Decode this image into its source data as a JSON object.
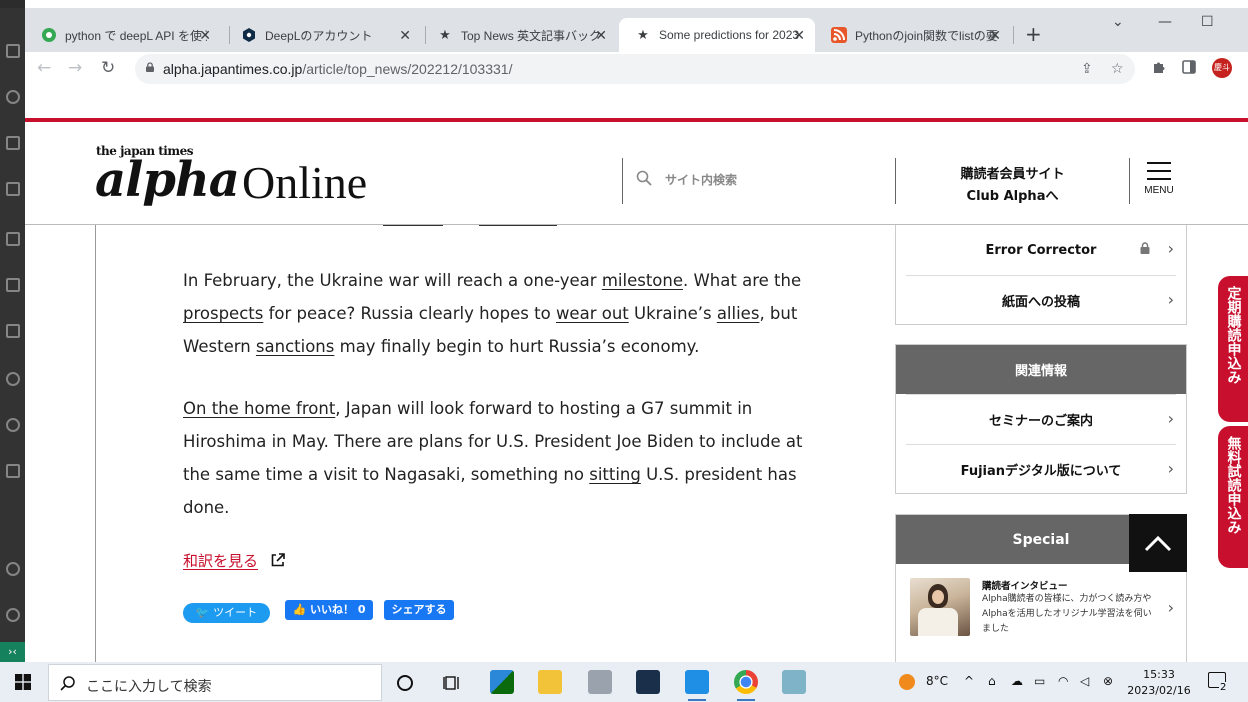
{
  "browser": {
    "tabs": [
      {
        "title": "python で deepL API を使う",
        "favicon": "circle-green-icon",
        "color": "#34a853"
      },
      {
        "title": "DeepLのアカウント",
        "favicon": "deepl-icon",
        "color": "#0f2b46"
      },
      {
        "title": "Top News 英文記事バックナ",
        "favicon": "star-icon",
        "color": "#111111"
      },
      {
        "title": "Some predictions for 2023",
        "favicon": "star-icon",
        "color": "#111111"
      },
      {
        "title": "Pythonのjoin関数でlistの要",
        "favicon": "rss-icon",
        "color": "#e8572a"
      }
    ],
    "address": {
      "host": "alpha.japantimes.co.jp",
      "path": "/article/top_news/202212/103331/"
    },
    "profile_initials": "慶斗"
  },
  "site": {
    "logo_small": "the japan times",
    "logo_alpha": "alpha",
    "logo_online": "Online",
    "search_placeholder": "サイト内検索",
    "club_line1": "購読者会員サイト",
    "club_line2": "Club Alphaへ",
    "menu_label": "MENU",
    "accent": "#c8102e"
  },
  "article": {
    "para1": {
      "t0": "In February, the Ukraine war will reach a one-year ",
      "milestone": "milestone",
      "t1": ". What are the",
      "prospects": "prospects",
      "t2": " for peace? Russia clearly hopes to ",
      "wear_out": "wear out",
      "t3": " Ukraine’s ",
      "allies": "allies",
      "t4": ", but",
      "t5": "Western ",
      "sanctions": "sanctions",
      "t6": " may finally begin to hurt Russia’s economy."
    },
    "para2": {
      "home_front": "On the home front",
      "t0": ", Japan will look forward to hosting a G7 summit in",
      "t1": "Hiroshima in May. There are plans for U.S. President Joe Biden to include at",
      "t2": "the same time a visit to Nagasaki, something no ",
      "sitting": "sitting",
      "t3": " U.S. president has",
      "t4": "done."
    },
    "translation_link": "和訳を見る",
    "tweet_label": "ツイート",
    "like_label": "いいね！ 0",
    "share_label": "シェアする"
  },
  "sidebar": {
    "tools": [
      {
        "label": "Error Corrector",
        "locked": true
      },
      {
        "label": "紙面への投稿",
        "locked": false
      }
    ],
    "related_heading": "関連情報",
    "related": [
      {
        "label": "セミナーのご案内"
      },
      {
        "label": "Fujianデジタル版について"
      }
    ],
    "special_heading": "Special",
    "interview_title": "購読者インタビュー",
    "interview_desc": "Alpha購読者の皆様に、力がつく読み方やAlphaを活用したオリジナル学習法を伺いました"
  },
  "side_tabs": [
    {
      "label": "定期購読申込み"
    },
    {
      "label": "無料試読申込み"
    }
  ],
  "taskbar": {
    "search_placeholder": "ここに入力して検索",
    "weather": "8°C",
    "time": "15:33",
    "date": "2023/02/16",
    "notifications": "2"
  }
}
